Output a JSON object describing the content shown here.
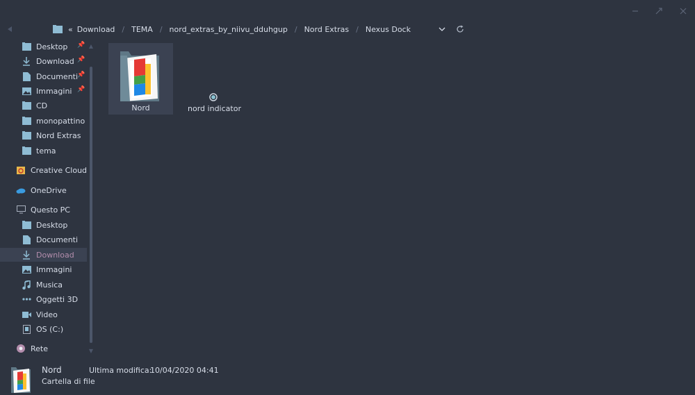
{
  "window": {
    "controls": [
      "minimize-icon",
      "maximize-icon",
      "close-icon"
    ]
  },
  "address": {
    "segments": [
      "Download",
      "TEMA",
      "nord_extras_by_niivu_dduhgup",
      "Nord Extras",
      "Nexus Dock"
    ],
    "overflow_glyph": "«",
    "separator": "/"
  },
  "sidebar": {
    "quick_access": [
      {
        "label": "Desktop",
        "icon": "desktop-folder-icon",
        "pinned": true
      },
      {
        "label": "Download",
        "icon": "download-arrow-icon",
        "pinned": true
      },
      {
        "label": "Documenti",
        "icon": "document-icon",
        "pinned": true
      },
      {
        "label": "Immagini",
        "icon": "image-icon",
        "pinned": true
      },
      {
        "label": "CD",
        "icon": "folder-icon",
        "pinned": false
      },
      {
        "label": "monopattino",
        "icon": "folder-icon",
        "pinned": false
      },
      {
        "label": "Nord Extras",
        "icon": "folder-icon",
        "pinned": false
      },
      {
        "label": "tema",
        "icon": "folder-icon",
        "pinned": false
      }
    ],
    "creative_cloud": {
      "label": "Creative Cloud Fil",
      "icon": "creative-cloud-icon"
    },
    "onedrive": {
      "label": "OneDrive",
      "icon": "cloud-icon"
    },
    "this_pc": {
      "label": "Questo PC",
      "icon": "computer-icon"
    },
    "pc_items": [
      {
        "label": "Desktop",
        "icon": "desktop-folder-icon",
        "selected": false
      },
      {
        "label": "Documenti",
        "icon": "document-icon",
        "selected": false
      },
      {
        "label": "Download",
        "icon": "download-arrow-icon",
        "selected": true
      },
      {
        "label": "Immagini",
        "icon": "image-icon",
        "selected": false
      },
      {
        "label": "Musica",
        "icon": "music-note-icon",
        "selected": false
      },
      {
        "label": "Oggetti 3D",
        "icon": "objects-3d-icon",
        "selected": false
      },
      {
        "label": "Video",
        "icon": "video-icon",
        "selected": false
      },
      {
        "label": "OS (C:)",
        "icon": "drive-icon",
        "selected": false
      }
    ],
    "network": {
      "label": "Rete",
      "icon": "network-icon"
    }
  },
  "content": {
    "items": [
      {
        "label": "Nord",
        "icon": "nord-folder-icon",
        "selected": true
      },
      {
        "label": "nord indicator",
        "icon": "indicator-dot-icon",
        "selected": false
      }
    ]
  },
  "details": {
    "name": "Nord",
    "type": "Cartella di file",
    "modified_label": "Ultima modifica:",
    "modified_value": "10/04/2020 04:41"
  },
  "colors": {
    "background": "#2e3440",
    "selection": "#3b4252",
    "accent": "#b48ead",
    "text": "#d8dee9",
    "folder": "#8fbcd4"
  }
}
